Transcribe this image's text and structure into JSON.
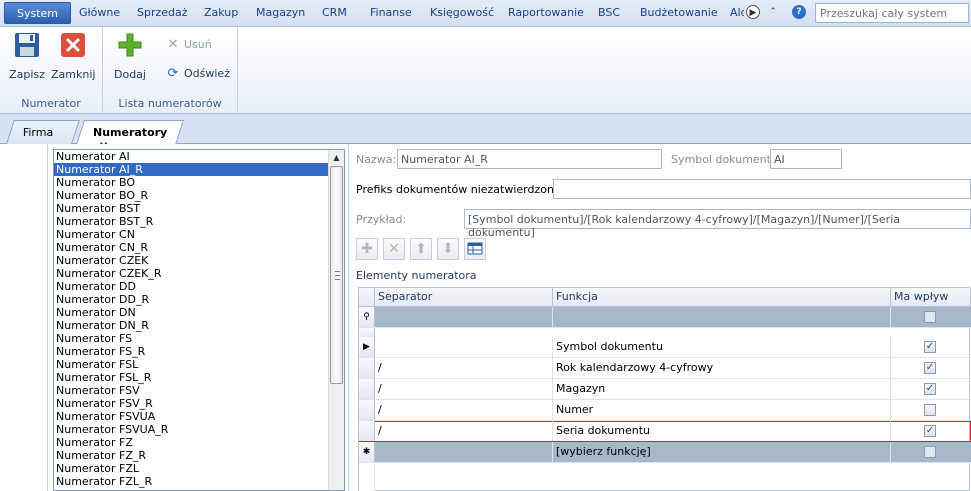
{
  "menu": {
    "items": [
      "System",
      "Główne",
      "Sprzedaż",
      "Zakup",
      "Magazyn",
      "CRM",
      "Finanse",
      "Księgowość",
      "Raportowanie",
      "BSC",
      "Budżetowanie",
      "Alo"
    ],
    "active": "System",
    "search_placeholder": "Przeszukaj cały system"
  },
  "ribbon": {
    "save_label": "Zapisz",
    "close_label": "Zamknij",
    "group1_label": "Numerator",
    "add_label": "Dodaj",
    "delete_label": "Usuń",
    "refresh_label": "Odśwież",
    "group2_label": "Lista numeratorów"
  },
  "tabs": [
    {
      "label": "Firma",
      "active": false
    },
    {
      "label": "Numeratory",
      "active": true
    }
  ],
  "tab_close_glyph": "✕",
  "numerators": {
    "items": [
      "Numerator AI",
      "Numerator AI_R",
      "Numerator BO",
      "Numerator BO_R",
      "Numerator BST",
      "Numerator BST_R",
      "Numerator CN",
      "Numerator CN_R",
      "Numerator CZEK",
      "Numerator CZEK_R",
      "Numerator DD",
      "Numerator DD_R",
      "Numerator DN",
      "Numerator DN_R",
      "Numerator FS",
      "Numerator FS_R",
      "Numerator FSL",
      "Numerator FSL_R",
      "Numerator FSV",
      "Numerator FSV_R",
      "Numerator FSVUA",
      "Numerator FSVUA_R",
      "Numerator FZ",
      "Numerator FZ_R",
      "Numerator FZL",
      "Numerator FZL_R"
    ],
    "selected": "Numerator AI_R"
  },
  "form": {
    "name_label": "Nazwa:",
    "name_value": "Numerator AI_R",
    "symbol_label": "Symbol dokumentu:",
    "symbol_value": "AI",
    "prefix_label": "Prefiks dokumentów niezatwierdzonych:",
    "prefix_value": "",
    "example_label": "Przykład:",
    "example_value": "[Symbol dokumentu]/[Rok kalendarzowy 4-cyfrowy]/[Magazyn]/[Numer]/[Seria dokumentu]"
  },
  "elements": {
    "title": "Elementy numeratora",
    "columns": {
      "separator": "Separator",
      "function": "Funkcja",
      "impact": "Ma wpływ"
    },
    "rows": [
      {
        "separator": "",
        "function": "Symbol dokumentu",
        "impact": true
      },
      {
        "separator": "/",
        "function": "Rok kalendarzowy 4-cyfrowy",
        "impact": true
      },
      {
        "separator": "/",
        "function": "Magazyn",
        "impact": true
      },
      {
        "separator": "/",
        "function": "Numer",
        "impact": false
      },
      {
        "separator": "/",
        "function": "Seria dokumentu",
        "impact": true
      }
    ],
    "new_row_function": "[wybierz funkcję]"
  },
  "colors": {
    "accent": "#2d5fb3",
    "selection": "#3169c6",
    "grid_band": "#a8b8cb",
    "highlight_border": "#dd2222"
  }
}
